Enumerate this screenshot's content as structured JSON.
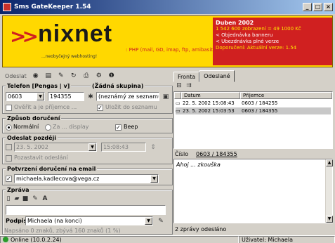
{
  "window": {
    "title": "Sms GateKeeper 1.54"
  },
  "banner": {
    "brand": "nixnet",
    "tagline": "...neobyčejný webhosting!",
    "services": ": PHP (mail, GD, imap, ftp, amibasit)",
    "promo": {
      "title": "Duben 2002",
      "line1": "1 542 600 zobrazení = 49 1000 Kč",
      "line2": "< Objednávka banneru",
      "line3": "< Ubezdnávka plné verze",
      "line4": "Doporučení: Aktuální verze: 1.54"
    }
  },
  "toolbar": {
    "send_label": "Odeslat"
  },
  "tabs": {
    "inbox": "Fronta",
    "sent": "Odeslané"
  },
  "phone_group": {
    "title": "Telefon [Pengas | v]",
    "recipient_title": "(Žádná skupina)",
    "prefix": "0603",
    "number": "194355",
    "recipient": "(neznámý ze seznamu)",
    "save_to_book_label": "Uložit do seznamu",
    "show_group_label": "Ověřit a je příjemce ..."
  },
  "delivery_group": {
    "title": "Způsob doručení",
    "normal_label": "Normální",
    "flash_label": "Za ... display",
    "beep_label": "Beep"
  },
  "later_group": {
    "title": "Odeslat později",
    "date": "23. 5. 2002",
    "time": "15:08:43",
    "postpone_label": "Pozastavit odeslání"
  },
  "email_group": {
    "title": "Potvrzení doručení na email",
    "email": "michaela.kadlecova@vega.cz"
  },
  "message_group": {
    "title": "Zpráva",
    "signature_label": "Podpis",
    "signature_value": "Michaela (na konci)",
    "counter": "Napsáno 0 znaků, zbývá 160 znaků (1 %)"
  },
  "sent_list": {
    "headers": {
      "date": "Datum",
      "recipient": "Příjemce"
    },
    "rows": [
      {
        "date": "22. 5. 2002 15:08:43",
        "recipient": "0603 / 184255"
      },
      {
        "date": "23. 5. 2002 15:03:53",
        "recipient": "0603 / 184355"
      }
    ]
  },
  "detail": {
    "number_label": "Číslo",
    "number_value": "0603 / 184355",
    "message_preview": "Ahoj ... zkouška",
    "sent_count": "2 zprávy odesláno"
  },
  "statusbar": {
    "online": "Online (10.0.2.24)",
    "user": "Uživatel: Michaela"
  }
}
